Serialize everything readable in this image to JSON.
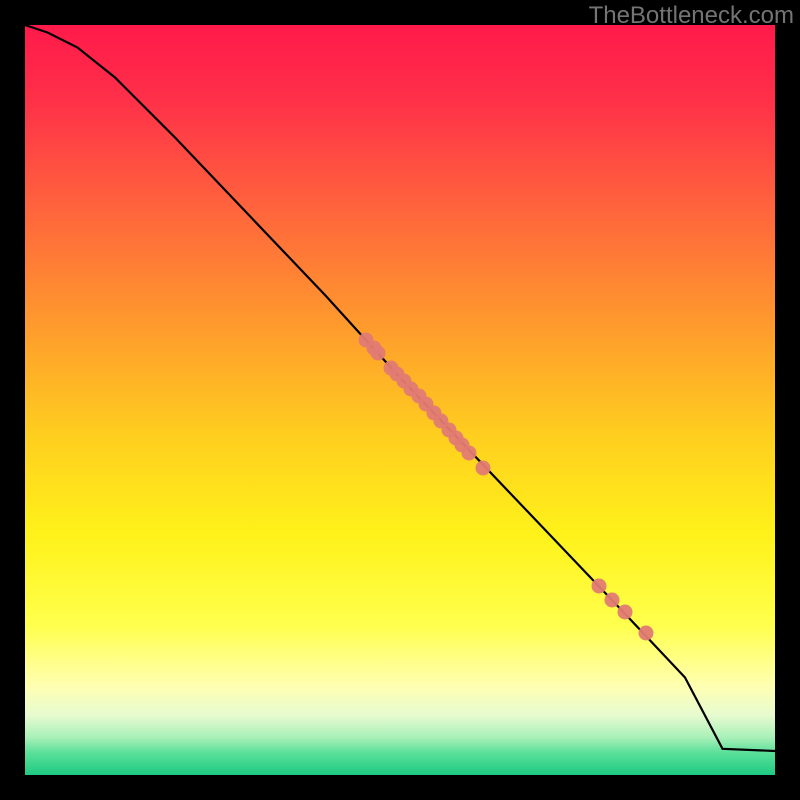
{
  "watermark": "TheBottleneck.com",
  "colors": {
    "dot": "#e17b73",
    "line": "#000000",
    "gradient_stops": [
      {
        "offset": 0.0,
        "color": "#ff1a4a"
      },
      {
        "offset": 0.1,
        "color": "#ff3049"
      },
      {
        "offset": 0.25,
        "color": "#ff663c"
      },
      {
        "offset": 0.4,
        "color": "#ff9a2d"
      },
      {
        "offset": 0.55,
        "color": "#ffcf1f"
      },
      {
        "offset": 0.68,
        "color": "#fff21a"
      },
      {
        "offset": 0.8,
        "color": "#ffff4d"
      },
      {
        "offset": 0.88,
        "color": "#ffffb0"
      },
      {
        "offset": 0.92,
        "color": "#e8fbd0"
      },
      {
        "offset": 0.95,
        "color": "#a8f0b8"
      },
      {
        "offset": 0.97,
        "color": "#5ce09a"
      },
      {
        "offset": 1.0,
        "color": "#1dca82"
      }
    ]
  },
  "chart_data": {
    "type": "line",
    "title": "",
    "xlabel": "",
    "ylabel": "",
    "xlim": [
      0,
      100
    ],
    "ylim": [
      0,
      100
    ],
    "series": [
      {
        "name": "curve",
        "x": [
          0,
          3,
          7,
          12,
          20,
          30,
          40,
          50,
          60,
          70,
          80,
          88,
          93,
          100
        ],
        "y": [
          100,
          99,
          97,
          93,
          85,
          74.5,
          64,
          53,
          42.5,
          32,
          21.5,
          13,
          3.5,
          3.2
        ]
      }
    ],
    "points": [
      {
        "x": 45.5,
        "y": 58.0
      },
      {
        "x": 46.5,
        "y": 57.0
      },
      {
        "x": 47.0,
        "y": 56.3
      },
      {
        "x": 48.8,
        "y": 54.3
      },
      {
        "x": 49.6,
        "y": 53.5
      },
      {
        "x": 50.5,
        "y": 52.5
      },
      {
        "x": 51.5,
        "y": 51.5
      },
      {
        "x": 52.5,
        "y": 50.5
      },
      {
        "x": 53.5,
        "y": 49.5
      },
      {
        "x": 54.5,
        "y": 48.3
      },
      {
        "x": 55.5,
        "y": 47.2
      },
      {
        "x": 56.5,
        "y": 46.0
      },
      {
        "x": 57.5,
        "y": 45.0
      },
      {
        "x": 58.3,
        "y": 44.0
      },
      {
        "x": 59.2,
        "y": 43.0
      },
      {
        "x": 61.0,
        "y": 41.0
      },
      {
        "x": 76.5,
        "y": 25.2
      },
      {
        "x": 78.3,
        "y": 23.4
      },
      {
        "x": 80.0,
        "y": 21.7
      },
      {
        "x": 82.8,
        "y": 19.0
      }
    ]
  }
}
